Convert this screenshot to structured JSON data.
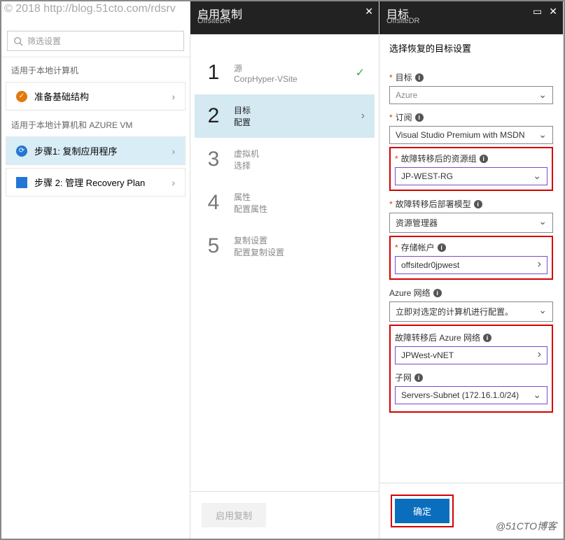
{
  "watermark": "© 2018 http://blog.51cto.com/rdsrv",
  "watermark_br": "@51CTO博客",
  "left_panel": {
    "search_placeholder": "筛选设置",
    "section1_label": "适用于本地计算机",
    "item_prep": "准备基础结构",
    "section2_label": "适用于本地计算机和 AZURE VM",
    "item_step1": "步骤1: 复制应用程序",
    "item_step2": "步骤 2: 管理 Recovery Plan"
  },
  "mid_panel": {
    "title": "启用复制",
    "subtitle": "OffsiteDR",
    "steps": [
      {
        "num": "1",
        "label": "源",
        "sub": "CorpHyper-VSite",
        "state": "complete"
      },
      {
        "num": "2",
        "label": "目标",
        "sub": "配置",
        "state": "active"
      },
      {
        "num": "3",
        "label": "虚拟机",
        "sub": "选择",
        "state": "pending"
      },
      {
        "num": "4",
        "label": "属性",
        "sub": "配置属性",
        "state": "pending"
      },
      {
        "num": "5",
        "label": "复制设置",
        "sub": "配置复制设置",
        "state": "pending"
      }
    ],
    "footer_btn": "启用复制"
  },
  "right_panel": {
    "title": "目标",
    "subtitle": "OffsiteDR",
    "desc": "选择恢复的目标设置",
    "fields": {
      "target_label": "目标",
      "target_value": "Azure",
      "sub_label": "订阅",
      "sub_value": "Visual Studio Premium with MSDN",
      "rg_label": "故障转移后的资源组",
      "rg_value": "JP-WEST-RG",
      "deploy_label": "故障转移后部署模型",
      "deploy_value": "资源管理器",
      "storage_label": "存储帐户",
      "storage_value": "offsitedr0jpwest",
      "aznet_label": "Azure 网络",
      "aznet_value": "立即对选定的计算机进行配置。",
      "postnet_label": "故障转移后 Azure 网络",
      "postnet_value": "JPWest-vNET",
      "subnet_label": "子网",
      "subnet_value": "Servers-Subnet (172.16.1.0/24)"
    },
    "footer_btn": "确定"
  }
}
